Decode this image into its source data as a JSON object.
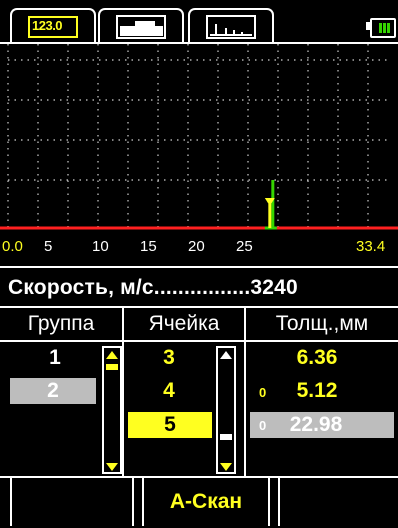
{
  "tabs": [
    {
      "icon": "digit-display-icon",
      "active": true
    },
    {
      "icon": "b-scan-icon",
      "active": false
    },
    {
      "icon": "a-scan-icon",
      "active": false
    }
  ],
  "tab_icon_digits": "123.0",
  "battery": {
    "icon": "battery-icon",
    "level": 0.7,
    "color": "#35d500"
  },
  "graph": {
    "x_range": [
      0,
      33.4
    ],
    "ticks": [
      "0.0",
      "5",
      "10",
      "15",
      "20",
      "25",
      "33.4"
    ],
    "marker_x": 22.98,
    "gate_color": "#ff2020",
    "signal_color": "#35d500",
    "marker_color": "#ffff20"
  },
  "speed": {
    "label": "Скорость, м/с................",
    "value": "3240"
  },
  "table": {
    "headers": [
      "Группа",
      "Ячейка",
      "Толщ.,мм"
    ],
    "groups": [
      "1",
      "2"
    ],
    "selected_group": "2",
    "cells": [
      "3",
      "4",
      "5"
    ],
    "selected_cell": "5",
    "thickness": [
      {
        "value": "6.36",
        "locked": false
      },
      {
        "value": "5.12",
        "locked": true
      },
      {
        "value": "22.98",
        "locked": true
      }
    ],
    "lock_glyph": "0"
  },
  "softkeys": [
    "",
    "А-Скан",
    ""
  ],
  "colors": {
    "accent": "#ffff20",
    "selection": "#bdbdbd",
    "background": "#000000"
  }
}
